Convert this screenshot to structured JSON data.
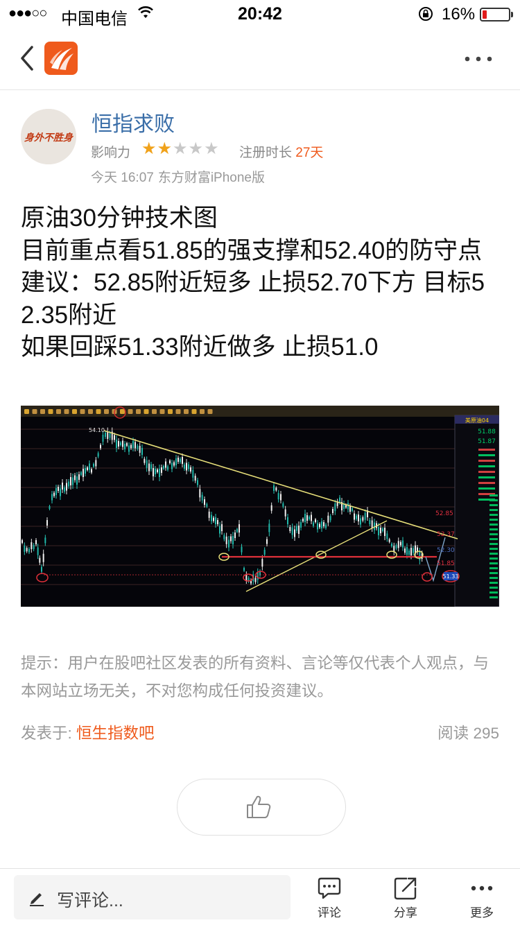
{
  "status_bar": {
    "signal": "●●●○○",
    "carrier": "中国电信",
    "time": "20:42",
    "battery": "16%",
    "battery_level": 0.16
  },
  "nav": {
    "back_icon": "chevron-left-icon",
    "logo_icon": "app-logo-icon",
    "more_icon": "ellipsis-icon"
  },
  "author": {
    "avatar_text": "身外不胜身",
    "name": "恒指求败",
    "influence_label": "影响力",
    "influence_stars": 2,
    "influence_stars_max": 5,
    "star_on": "★★",
    "star_off": "★★★",
    "reg_label": "注册时长",
    "reg_value": "27天",
    "post_time": "今天 16:07",
    "post_source": "东方财富iPhone版"
  },
  "post": {
    "lines": [
      "原油30分钟技术图",
      "目前重点看51.85的强支撑和52.40的防守点",
      "建议：52.85附近短多 止损52.70下方 目标52.35附近",
      "如果回踩51.33附近做多 止损51.0"
    ]
  },
  "chart_image": {
    "price_label_high": "54.10",
    "label_52_85": "52.85",
    "label_52_37": "52.37",
    "label_52_30": "52.30",
    "label_51_85": "51.85",
    "label_51_33": "51.33",
    "panel_title": "美原油04",
    "panel_price_1": "51.88",
    "panel_price_2": "51.87"
  },
  "disclaimer": {
    "text": "提示：用户在股吧社区发表的所有资料、言论等仅代表个人观点，与本网站立场无关，不对您构成任何投资建议。",
    "posted_in_label": "发表于:",
    "forum": "恒生指数吧",
    "reads_label": "阅读",
    "reads_count": "295"
  },
  "like": {
    "icon": "thumbs-up-icon"
  },
  "bottom_bar": {
    "comment_placeholder": "写评论...",
    "comment_label": "评论",
    "share_label": "分享",
    "more_label": "更多"
  },
  "colors": {
    "accent": "#ef5a1c",
    "author_blue": "#3a6ea8",
    "star": "#f0a21b",
    "muted": "#999999"
  }
}
